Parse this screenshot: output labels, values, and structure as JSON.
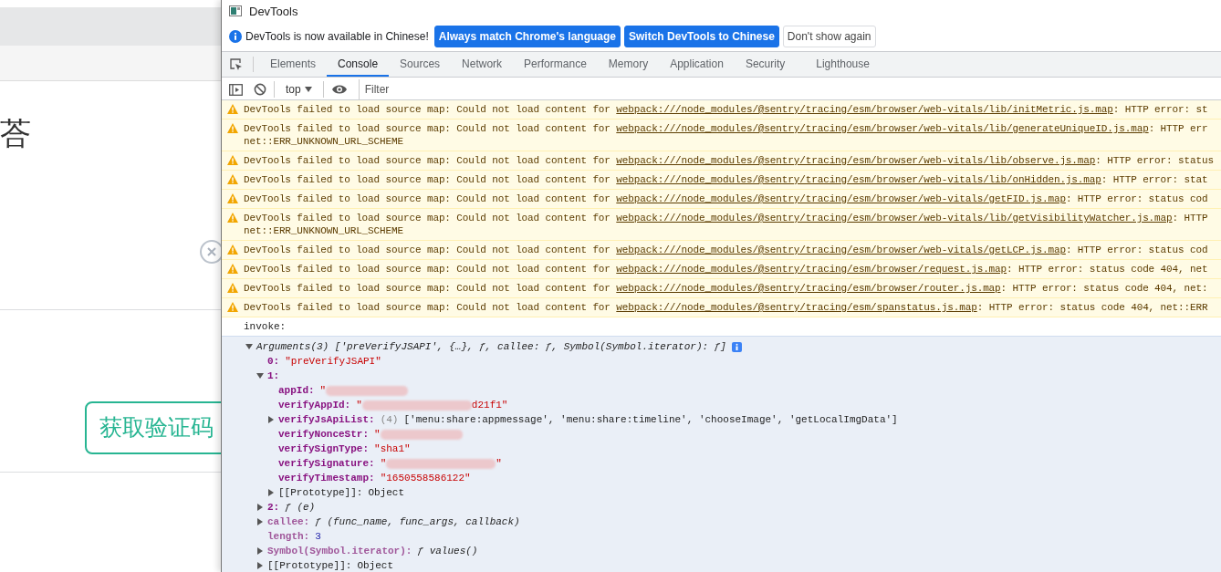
{
  "page": {
    "heading": "荅",
    "code_button": "获取验证码"
  },
  "devtools": {
    "title": "DevTools",
    "infobar": {
      "message": "DevTools is now available in Chinese!",
      "buttons": [
        {
          "label": "Always match Chrome's language",
          "kind": "primary"
        },
        {
          "label": "Switch DevTools to Chinese",
          "kind": "primary"
        },
        {
          "label": "Don't show again",
          "kind": "secondary"
        }
      ]
    },
    "tabs": [
      {
        "label": "Elements",
        "selected": false
      },
      {
        "label": "Console",
        "selected": true
      },
      {
        "label": "Sources",
        "selected": false
      },
      {
        "label": "Network",
        "selected": false
      },
      {
        "label": "Performance",
        "selected": false
      },
      {
        "label": "Memory",
        "selected": false
      },
      {
        "label": "Application",
        "selected": false
      },
      {
        "label": "Security",
        "selected": false
      },
      {
        "label": "Lighthouse",
        "selected": false
      }
    ],
    "toolbar": {
      "context": "top",
      "filter_placeholder": "Filter"
    },
    "warnings": [
      {
        "text": "DevTools failed to load source map: Could not load content for ",
        "link": "webpack:///node_modules/@sentry/tracing/esm/browser/web-vitals/lib/initMetric.js.map",
        "suffix": ": HTTP error: st"
      },
      {
        "text": "DevTools failed to load source map: Could not load content for ",
        "link": "webpack:///node_modules/@sentry/tracing/esm/browser/web-vitals/lib/generateUniqueID.js.map",
        "suffix": ": HTTP err",
        "continuation": "net::ERR_UNKNOWN_URL_SCHEME"
      },
      {
        "text": "DevTools failed to load source map: Could not load content for ",
        "link": "webpack:///node_modules/@sentry/tracing/esm/browser/web-vitals/lib/observe.js.map",
        "suffix": ": HTTP error: status"
      },
      {
        "text": "DevTools failed to load source map: Could not load content for ",
        "link": "webpack:///node_modules/@sentry/tracing/esm/browser/web-vitals/lib/onHidden.js.map",
        "suffix": ": HTTP error: stat"
      },
      {
        "text": "DevTools failed to load source map: Could not load content for ",
        "link": "webpack:///node_modules/@sentry/tracing/esm/browser/web-vitals/getFID.js.map",
        "suffix": ": HTTP error: status cod"
      },
      {
        "text": "DevTools failed to load source map: Could not load content for ",
        "link": "webpack:///node_modules/@sentry/tracing/esm/browser/web-vitals/lib/getVisibilityWatcher.js.map",
        "suffix": ": HTTP",
        "continuation": "net::ERR_UNKNOWN_URL_SCHEME"
      },
      {
        "text": "DevTools failed to load source map: Could not load content for ",
        "link": "webpack:///node_modules/@sentry/tracing/esm/browser/web-vitals/getLCP.js.map",
        "suffix": ": HTTP error: status cod"
      },
      {
        "text": "DevTools failed to load source map: Could not load content for ",
        "link": "webpack:///node_modules/@sentry/tracing/esm/browser/request.js.map",
        "suffix": ": HTTP error: status code 404, net"
      },
      {
        "text": "DevTools failed to load source map: Could not load content for ",
        "link": "webpack:///node_modules/@sentry/tracing/esm/browser/router.js.map",
        "suffix": ": HTTP error: status code 404, net:"
      },
      {
        "text": "DevTools failed to load source map: Could not load content for ",
        "link": "webpack:///node_modules/@sentry/tracing/esm/spanstatus.js.map",
        "suffix": ": HTTP error: status code 404, net::ERR"
      }
    ],
    "log": "invoke:",
    "tree": [
      {
        "kind": "summary",
        "value": "Arguments(3) ['preVerifyJSAPI', {…}, ƒ, callee: ƒ, Symbol(Symbol.iterator): ƒ]",
        "expanded": true,
        "children": [
          {
            "kind": "string",
            "key": "0:",
            "value": "\"preVerifyJSAPI\"",
            "dimmed": false,
            "internal": false
          },
          {
            "kind": "object",
            "key": "1:",
            "expanded": true,
            "dimmed": false,
            "internal": false,
            "children": [
              {
                "kind": "string",
                "key": "appId:",
                "value": "\"",
                "redacted": true,
                "dimmed": false,
                "internal": false
              },
              {
                "kind": "string",
                "key": "verifyAppId:",
                "value": "\"",
                "redacted": true,
                "tail": "d21f1\"",
                "dimmed": false,
                "internal": false
              },
              {
                "kind": "array",
                "key": "verifyJsApiList:",
                "count": "(4)",
                "value": "['menu:share:appmessage', 'menu:share:timeline', 'chooseImage', 'getLocalImgData']",
                "expanded": false,
                "dimmed": false,
                "internal": false
              },
              {
                "kind": "string",
                "key": "verifyNonceStr:",
                "value": "\"",
                "redacted": true,
                "dimmed": false,
                "internal": false
              },
              {
                "kind": "string",
                "key": "verifySignType:",
                "value": "\"sha1\"",
                "dimmed": false,
                "internal": false
              },
              {
                "kind": "string",
                "key": "verifySignature:",
                "value": "\"",
                "redacted": true,
                "tail": "\"",
                "dimmed": false,
                "internal": false
              },
              {
                "kind": "string",
                "key": "verifyTimestamp:",
                "value": "\"1650558586122\"",
                "dimmed": false,
                "internal": false
              },
              {
                "kind": "object",
                "key": "[[Prototype]]:",
                "value": "Object",
                "expanded": false,
                "dimmed": false,
                "internal": true
              }
            ]
          },
          {
            "kind": "function",
            "key": "2:",
            "value": "ƒ (e)",
            "expanded": false,
            "dimmed": false,
            "internal": false
          },
          {
            "kind": "function",
            "key": "callee:",
            "value": "ƒ (func_name, func_args, callback)",
            "expanded": false,
            "dimmed": true,
            "internal": false
          },
          {
            "kind": "number",
            "key": "length:",
            "value": "3",
            "dimmed": true,
            "internal": false
          },
          {
            "kind": "function",
            "key": "Symbol(Symbol.iterator):",
            "value": "ƒ values()",
            "expanded": false,
            "dimmed": true,
            "internal": false
          },
          {
            "kind": "object",
            "key": "[[Prototype]]:",
            "value": "Object",
            "expanded": false,
            "dimmed": false,
            "internal": true
          }
        ]
      }
    ]
  }
}
